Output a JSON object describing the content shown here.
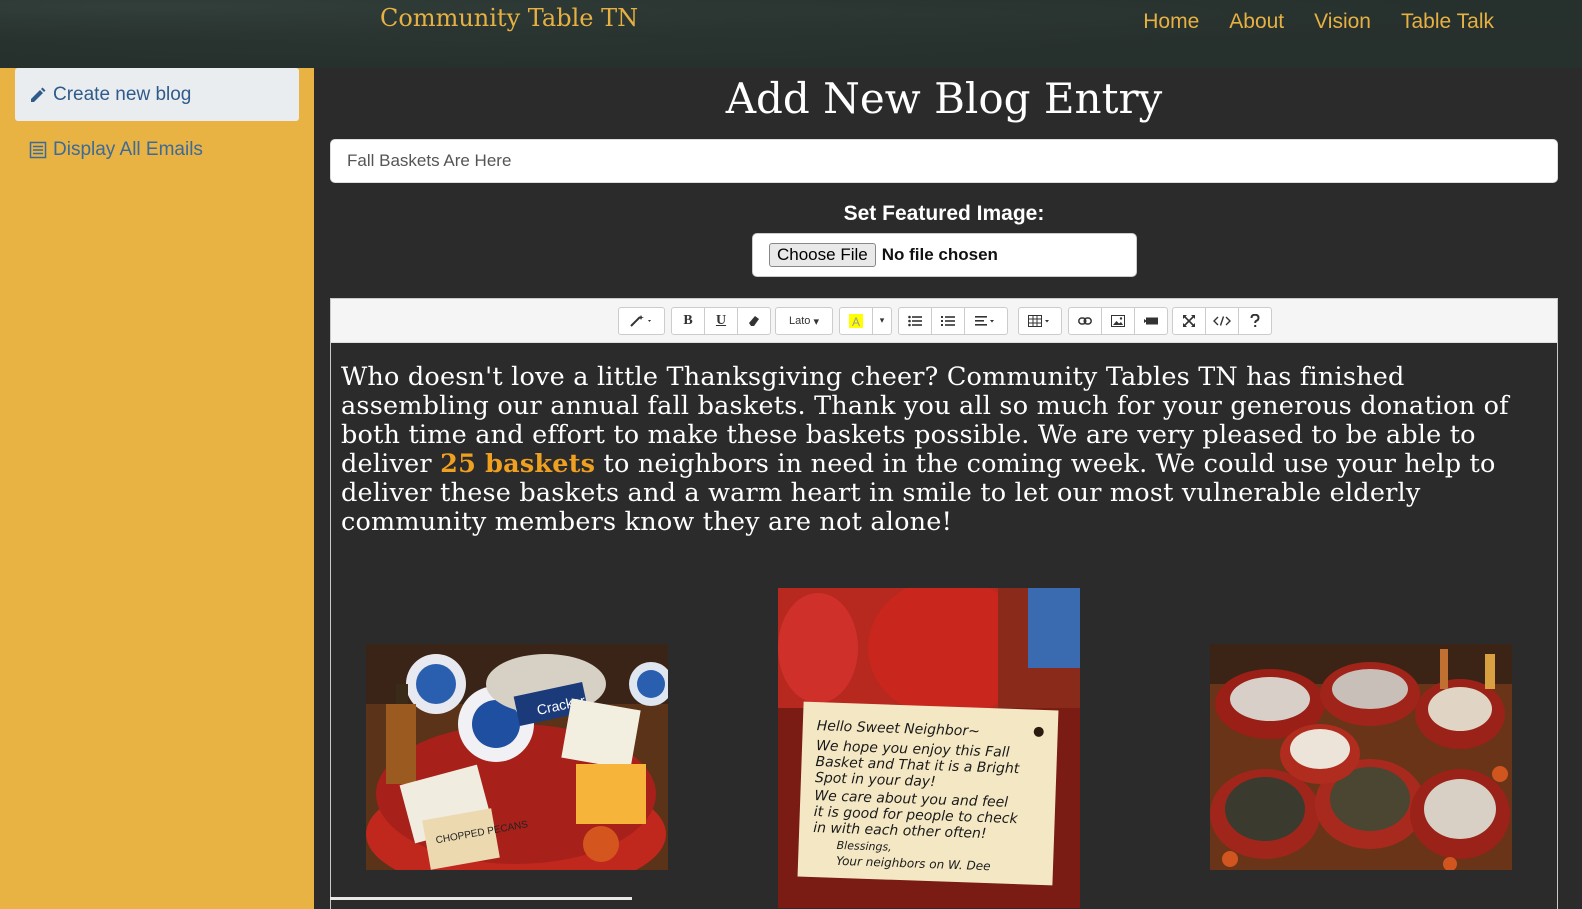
{
  "header": {
    "brand": "Community Table TN",
    "nav": [
      "Home",
      "About",
      "Vision",
      "Table Talk"
    ]
  },
  "sidebar": {
    "items": [
      {
        "label": "Create new blog",
        "icon": "pencil-icon"
      },
      {
        "label": "Display All Emails",
        "icon": "list-icon"
      }
    ]
  },
  "main": {
    "title": "Add New Blog Entry",
    "title_input_value": "Fall Baskets Are Here",
    "featured_label": "Set Featured Image:",
    "file_button": "Choose File",
    "file_status": "No file chosen"
  },
  "editor": {
    "toolbar": {
      "font_name": "Lato"
    },
    "content": {
      "before": "Who doesn't love a little Thanksgiving cheer?  Community Tables TN has finished assembling our annual fall baskets. Thank you all so much for your generous donation of both time and effort to make these baskets possible. We are very pleased to be able to deliver ",
      "highlight": "25 baskets",
      "after": " to neighbors in need in the coming week. We could use your help to deliver these baskets and a warm heart in smile to let our most vulnerable elderly community members know they are not alone!"
    },
    "note_card": {
      "lines": [
        "Hello Sweet Neighbor~",
        "We hope you enjoy this Fall",
        "Basket and That it is a Bright",
        "Spot in your day!",
        "We care about you and feel",
        "it is good for people to check",
        "in with each other often!",
        "Blessings,",
        "Your neighbors on W. Dee"
      ]
    },
    "photo_labels": {
      "pecans": "CHOPPED PECANS",
      "cracker": "Cracker"
    }
  },
  "colors": {
    "accent": "#e6b142",
    "sidebar_bg": "#e8b343",
    "page_bg": "#2b2b2b",
    "highlight": "#f0a020"
  }
}
